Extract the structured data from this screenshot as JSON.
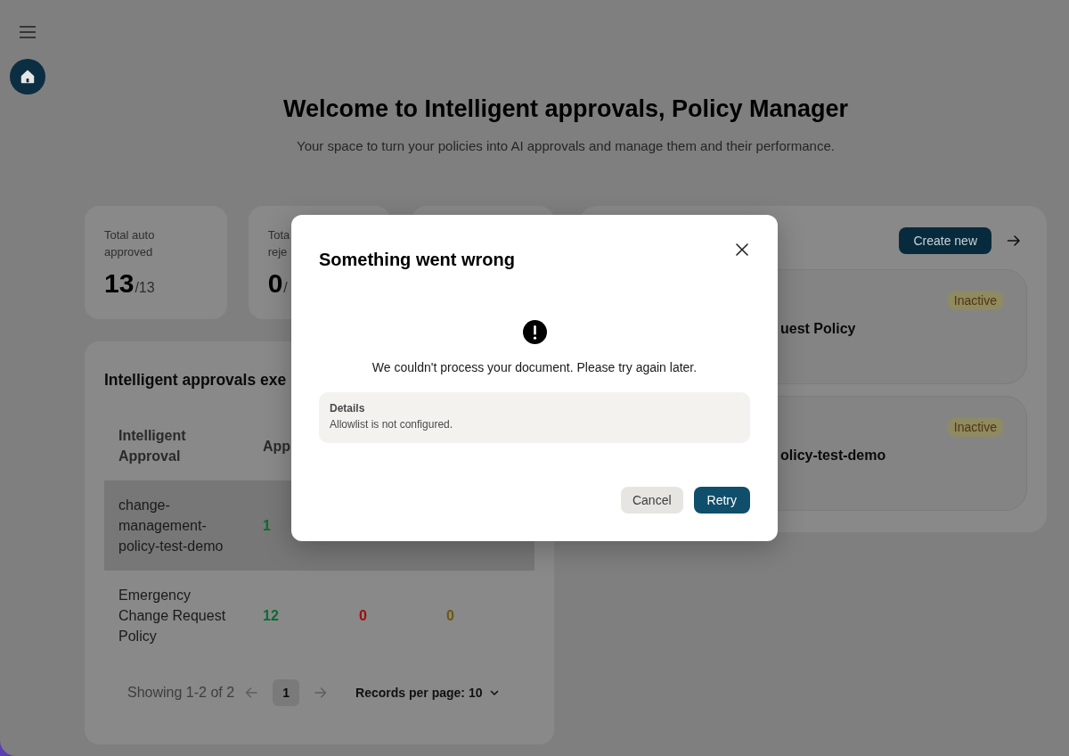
{
  "page": {
    "title": "Welcome to Intelligent approvals, Policy Manager",
    "subtitle": "Your space to turn your policies into AI approvals and manage them and their performance."
  },
  "stats": [
    {
      "label_lines": [
        "Total auto",
        "approved"
      ],
      "value": "13",
      "total": "/13"
    },
    {
      "label_lines": [
        "Tota",
        "reje"
      ],
      "value": "0",
      "total": "/"
    }
  ],
  "executions_table": {
    "title": "Intelligent approvals exe",
    "columns": [
      "Intelligent Approval",
      "App"
    ],
    "rows": [
      {
        "selected": true,
        "cells": [
          {
            "text": "change-management-policy-test-demo"
          },
          {
            "text": "1",
            "color": "#0b6b37"
          }
        ]
      },
      {
        "selected": false,
        "cells": [
          {
            "text": "Emergency Change Request Policy"
          },
          {
            "text": "12",
            "color": "#0b6b37"
          },
          {
            "text": "0",
            "color": "#a00d0d"
          },
          {
            "text": "0",
            "color": "#6b5a0f"
          }
        ]
      }
    ],
    "pagination": {
      "summary": "Showing 1-2 of 2",
      "pages": [
        {
          "label": "1",
          "selected": true
        }
      ],
      "page_size": "Records per page: 10"
    }
  },
  "policies_panel": {
    "create_button": "Create new",
    "items": [
      {
        "status": "Inactive",
        "name": "uest Policy"
      },
      {
        "status": "Inactive",
        "name": "olicy-test-demo"
      }
    ]
  },
  "dialog": {
    "title": "Something went wrong",
    "message": "We couldn't process your document. Please try again later.",
    "details": {
      "label": "Details",
      "text": "Allowlist is not configured."
    },
    "buttons": [
      {
        "label": "Cancel",
        "kind": "secondary"
      },
      {
        "label": "Retry",
        "kind": "primary"
      }
    ]
  }
}
